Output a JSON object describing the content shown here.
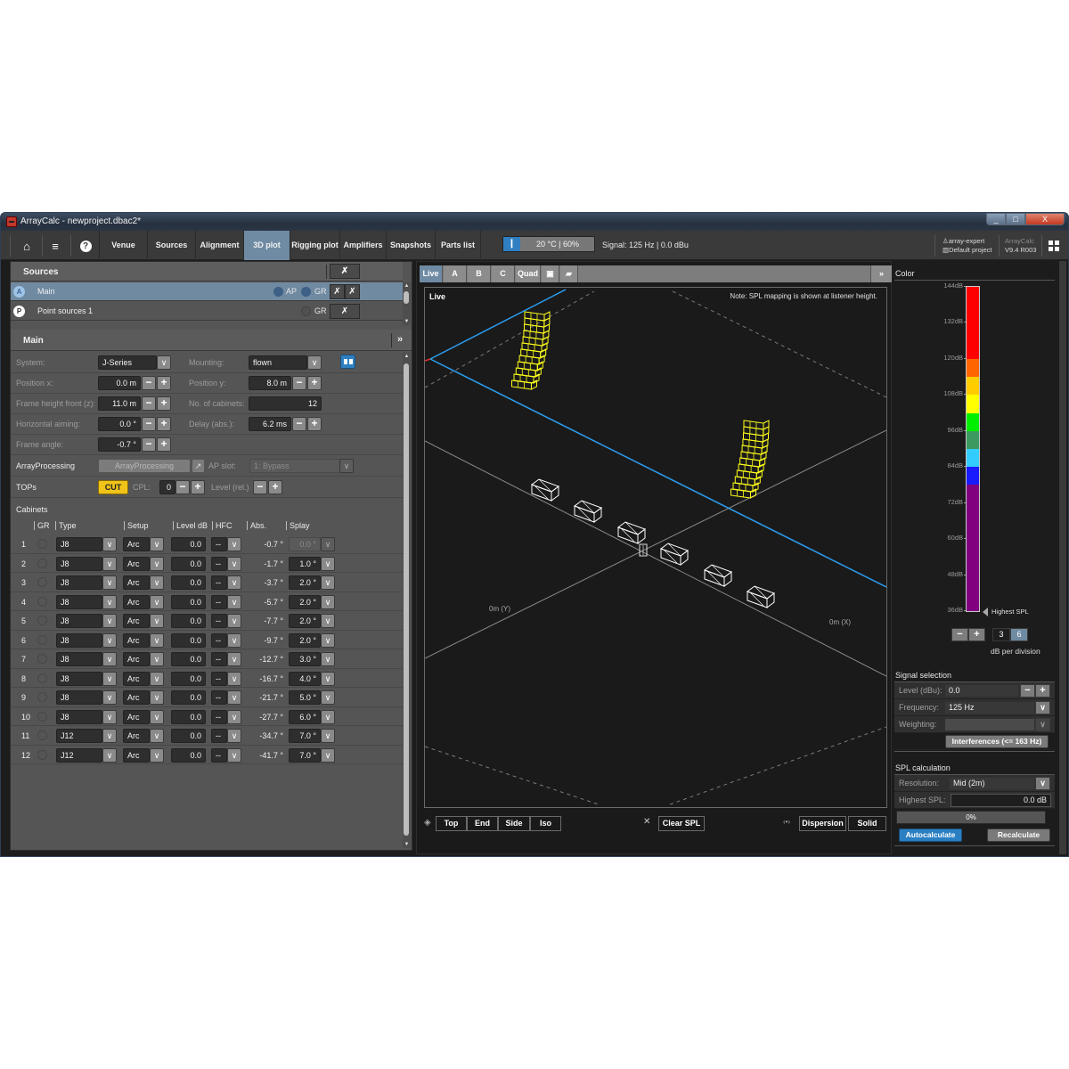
{
  "window": {
    "title": "ArrayCalc - newproject.dbac2*",
    "controls": {
      "minimize": "_",
      "maximize": "□",
      "close": "X"
    }
  },
  "toolbar": {
    "icons": {
      "home": "⌂",
      "menu": "≡",
      "help": "?"
    },
    "tabs": [
      {
        "label": "Venue",
        "active": false
      },
      {
        "label": "Sources",
        "active": false
      },
      {
        "label": "Alignment",
        "active": false
      },
      {
        "label": "3D plot",
        "active": true
      },
      {
        "label": "Rigging plot",
        "active": false
      },
      {
        "label": "Amplifiers",
        "active": false
      },
      {
        "label": "Snapshots",
        "active": false
      },
      {
        "label": "Parts list",
        "active": false
      }
    ],
    "climate": "20 °C | 60%",
    "signal": "Signal: 125 Hz | 0.0 dBu",
    "user": "array-expert",
    "project": "Default project",
    "app_name": "ArrayCalc",
    "version": "V9.4 R003"
  },
  "sources": {
    "title": "Sources",
    "items": [
      {
        "badge": "A",
        "name": "Main",
        "ap": "AP",
        "gr": "GR",
        "selected": true
      },
      {
        "badge": "P",
        "name": "Point sources 1",
        "gr": "GR",
        "selected": false
      }
    ]
  },
  "main": {
    "title": "Main",
    "expand": "»",
    "system_label": "System:",
    "system_value": "J-Series",
    "mounting_label": "Mounting:",
    "mounting_value": "flown",
    "pos_x_label": "Position x:",
    "pos_x_value": "0.0 m",
    "pos_y_label": "Position y:",
    "pos_y_value": "8.0 m",
    "frame_height_label": "Frame height front (z):",
    "frame_height_value": "11.0 m",
    "num_cabinets_label": "No. of cabinets:",
    "num_cabinets_value": "12",
    "h_aiming_label": "Horizontal aiming:",
    "h_aiming_value": "0.0 °",
    "delay_label": "Delay (abs.):",
    "delay_value": "6.2 ms",
    "frame_angle_label": "Frame angle:",
    "frame_angle_value": "-0.7 °",
    "ap_label": "ArrayProcessing",
    "ap_button": "ArrayProcessing",
    "ap_slot_label": "AP slot:",
    "ap_slot_value": "1: Bypass",
    "tops_label": "TOPs",
    "cut_button": "CUT",
    "cpl_label": "CPL:",
    "cpl_value": "0",
    "level_rel_label": "Level (rel.)",
    "minus": "−",
    "plus": "+",
    "chevron": "∨"
  },
  "cabinets": {
    "title": "Cabinets",
    "columns": [
      "GR",
      "Type",
      "Setup",
      "Level dB",
      "HFC",
      "Abs.",
      "Splay"
    ],
    "rows": [
      {
        "num": "1",
        "type": "J8",
        "setup": "Arc",
        "level": "0.0",
        "hfc": "--",
        "abs": "-0.7 °",
        "splay": "0.0 °",
        "splay_disabled": true
      },
      {
        "num": "2",
        "type": "J8",
        "setup": "Arc",
        "level": "0.0",
        "hfc": "--",
        "abs": "-1.7 °",
        "splay": "1.0 °"
      },
      {
        "num": "3",
        "type": "J8",
        "setup": "Arc",
        "level": "0.0",
        "hfc": "--",
        "abs": "-3.7 °",
        "splay": "2.0 °"
      },
      {
        "num": "4",
        "type": "J8",
        "setup": "Arc",
        "level": "0.0",
        "hfc": "--",
        "abs": "-5.7 °",
        "splay": "2.0 °"
      },
      {
        "num": "5",
        "type": "J8",
        "setup": "Arc",
        "level": "0.0",
        "hfc": "--",
        "abs": "-7.7 °",
        "splay": "2.0 °"
      },
      {
        "num": "6",
        "type": "J8",
        "setup": "Arc",
        "level": "0.0",
        "hfc": "--",
        "abs": "-9.7 °",
        "splay": "2.0 °"
      },
      {
        "num": "7",
        "type": "J8",
        "setup": "Arc",
        "level": "0.0",
        "hfc": "--",
        "abs": "-12.7 °",
        "splay": "3.0 °"
      },
      {
        "num": "8",
        "type": "J8",
        "setup": "Arc",
        "level": "0.0",
        "hfc": "--",
        "abs": "-16.7 °",
        "splay": "4.0 °"
      },
      {
        "num": "9",
        "type": "J8",
        "setup": "Arc",
        "level": "0.0",
        "hfc": "--",
        "abs": "-21.7 °",
        "splay": "5.0 °"
      },
      {
        "num": "10",
        "type": "J8",
        "setup": "Arc",
        "level": "0.0",
        "hfc": "--",
        "abs": "-27.7 °",
        "splay": "6.0 °"
      },
      {
        "num": "11",
        "type": "J12",
        "setup": "Arc",
        "level": "0.0",
        "hfc": "--",
        "abs": "-34.7 °",
        "splay": "7.0 °"
      },
      {
        "num": "12",
        "type": "J12",
        "setup": "Arc",
        "level": "0.0",
        "hfc": "--",
        "abs": "-41.7 °",
        "splay": "7.0 °"
      }
    ]
  },
  "plot": {
    "tabs": [
      {
        "label": "Live",
        "active": true
      },
      {
        "label": "A"
      },
      {
        "label": "B"
      },
      {
        "label": "C"
      },
      {
        "label": "Quad"
      }
    ],
    "save_icon": "💾",
    "open_icon": "📂",
    "expand": "»",
    "title": "Live",
    "note": "Note: SPL mapping is shown at listener height.",
    "axis_y_label": "0m (Y)",
    "axis_x_label": "0m (X)",
    "view_buttons": [
      "Top",
      "End",
      "Side",
      "Iso"
    ],
    "clear_icon": "✕",
    "clear_label": "Clear SPL",
    "dispersion_icon": "‹•›",
    "dispersion_label": "Dispersion",
    "solid_label": "Solid",
    "colors": {
      "array": "#ffff1a",
      "blue_line": "#2b9df0",
      "sub": "#ffffff"
    }
  },
  "color_panel": {
    "title": "Color",
    "ticks": [
      "144dB",
      "132dB",
      "120dB",
      "108dB",
      "96dB",
      "84dB",
      "72dB",
      "60dB",
      "48dB",
      "36dB"
    ],
    "scale_min_db": 36,
    "scale_max_db": 144,
    "bands": [
      {
        "from": 120,
        "to": 144,
        "color": "#ff0000"
      },
      {
        "from": 114,
        "to": 120,
        "color": "#ff6600"
      },
      {
        "from": 108,
        "to": 114,
        "color": "#ffcc00"
      },
      {
        "from": 102,
        "to": 108,
        "color": "#ffff00"
      },
      {
        "from": 96,
        "to": 102,
        "color": "#00ee00"
      },
      {
        "from": 90,
        "to": 96,
        "color": "#3c9a60"
      },
      {
        "from": 84,
        "to": 90,
        "color": "#33ccff"
      },
      {
        "from": 78,
        "to": 84,
        "color": "#1a1aff"
      },
      {
        "from": 36,
        "to": 78,
        "color": "#800080"
      }
    ],
    "highest_spl_label": "Highest SPL",
    "db_options": [
      "3",
      "6"
    ],
    "db_selected": "6",
    "db_per_division": "dB per division"
  },
  "signal_selection": {
    "title": "Signal selection",
    "level_label": "Level (dBu):",
    "level_value": "0.0",
    "frequency_label": "Frequency:",
    "frequency_value": "125 Hz",
    "weighting_label": "Weighting:",
    "weighting_value": "",
    "interferences_button": "Interferences (<= 163 Hz)"
  },
  "spl_calc": {
    "title": "SPL calculation",
    "resolution_label": "Resolution:",
    "resolution_value": "Mid (2m)",
    "highest_spl_label": "Highest SPL:",
    "highest_spl_value": "0.0 dB",
    "progress_percent": 0,
    "progress_text": "0%",
    "autocalculate": "Autocalculate",
    "recalculate": "Recalculate"
  }
}
